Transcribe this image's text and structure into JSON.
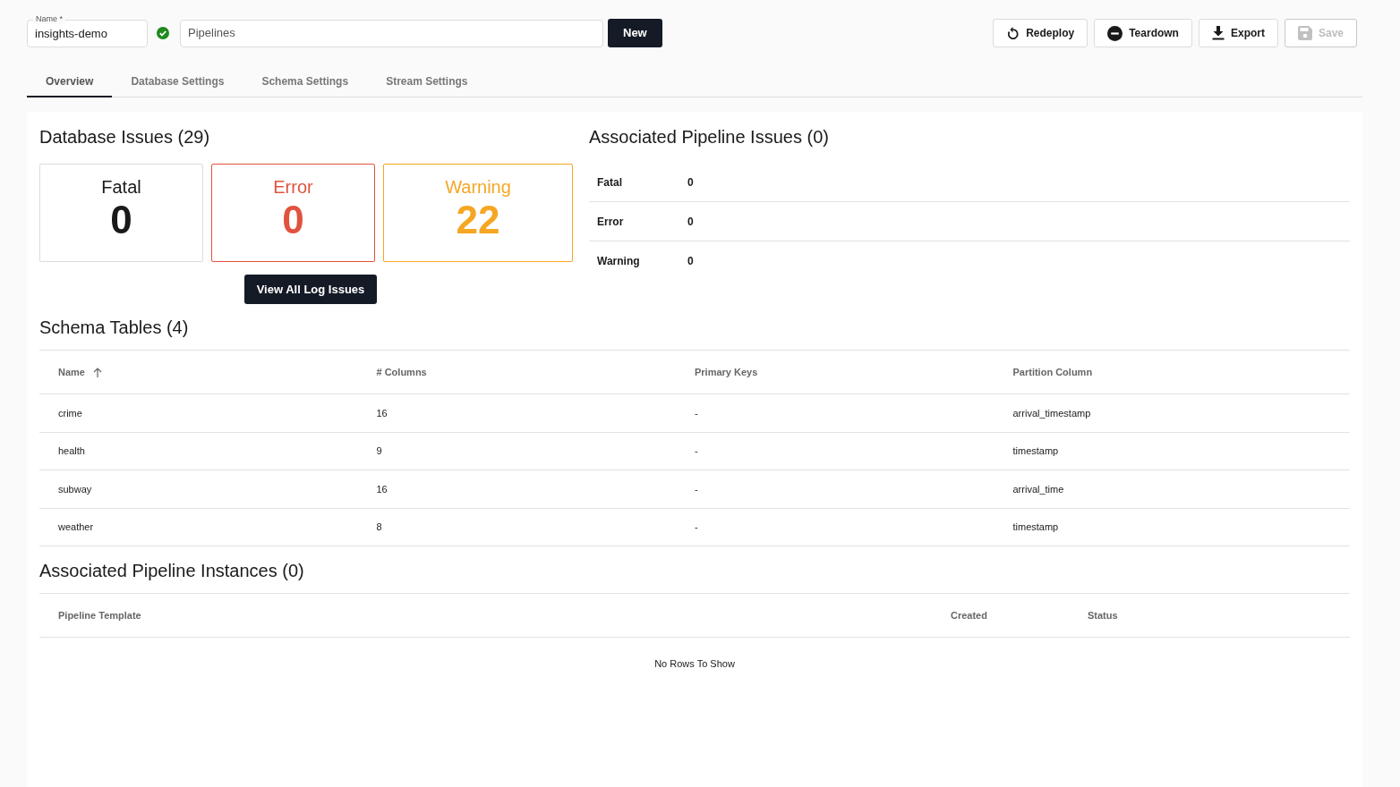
{
  "header": {
    "name_field": {
      "label": "Name *",
      "value": "insights-demo",
      "valid": true
    },
    "template_field": {
      "value": "Pipelines"
    },
    "new_button": "New",
    "actions": [
      {
        "kind": "redeploy",
        "label": "Redeploy",
        "disabled": false
      },
      {
        "kind": "teardown",
        "label": "Teardown",
        "disabled": false
      },
      {
        "kind": "export",
        "label": "Export",
        "disabled": false
      },
      {
        "kind": "save",
        "label": "Save",
        "disabled": true
      }
    ]
  },
  "tabs": [
    {
      "label": "Overview",
      "selected": true
    },
    {
      "label": "Database Settings",
      "selected": false
    },
    {
      "label": "Schema Settings",
      "selected": false
    },
    {
      "label": "Stream Settings",
      "selected": false
    }
  ],
  "database_issues": {
    "title": "Database Issues (29)",
    "cards": [
      {
        "kind": "fatal",
        "label": "Fatal",
        "count": "0"
      },
      {
        "kind": "error",
        "label": "Error",
        "count": "0"
      },
      {
        "kind": "warning",
        "label": "Warning",
        "count": "22"
      }
    ],
    "button": "View All Log Issues"
  },
  "pipeline_issues": {
    "title": "Associated Pipeline Issues (0)",
    "rows": [
      {
        "label": "Fatal",
        "count": "0"
      },
      {
        "label": "Error",
        "count": "0"
      },
      {
        "label": "Warning",
        "count": "0"
      }
    ]
  },
  "schema_tables": {
    "title": "Schema Tables (4)",
    "columns": [
      {
        "label": "Name",
        "sorted": true
      },
      {
        "label": "# Columns",
        "sorted": false
      },
      {
        "label": "Primary Keys",
        "sorted": false
      },
      {
        "label": "Partition Column",
        "sorted": false
      }
    ],
    "rows": [
      [
        "crime",
        "16",
        "-",
        "arrival_timestamp"
      ],
      [
        "health",
        "9",
        "-",
        "timestamp"
      ],
      [
        "subway",
        "16",
        "-",
        "arrival_time"
      ],
      [
        "weather",
        "8",
        "-",
        "timestamp"
      ]
    ]
  },
  "pipeline_instances": {
    "title": "Associated Pipeline Instances (0)",
    "columns": [
      "Pipeline Template",
      "Created",
      "Status"
    ],
    "empty_text": "No Rows To Show"
  }
}
